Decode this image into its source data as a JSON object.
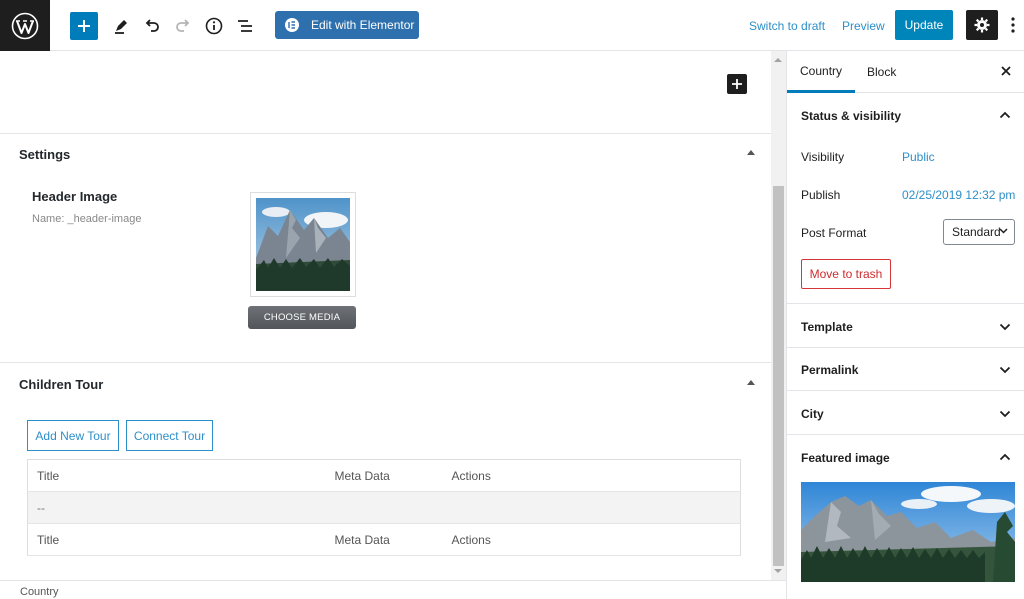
{
  "toolbar": {
    "edit_elementor_label": "Edit with Elementor",
    "switch_draft_label": "Switch to draft",
    "preview_label": "Preview",
    "update_label": "Update"
  },
  "settings_box": {
    "title": "Settings",
    "field_label": "Header Image",
    "field_name": "Name: _header-image",
    "choose_media_label": "CHOOSE MEDIA"
  },
  "children_box": {
    "title": "Children Tour",
    "add_new_label": "Add New Tour",
    "connect_label": "Connect Tour",
    "table": {
      "header": [
        "Title",
        "Meta Data",
        "Actions"
      ],
      "empty_row": "--",
      "footer": [
        "Title",
        "Meta Data",
        "Actions"
      ]
    }
  },
  "sidebar": {
    "tabs": [
      {
        "label": "Country",
        "active": true
      },
      {
        "label": "Block",
        "active": false
      }
    ],
    "status_panel": {
      "title": "Status & visibility",
      "visibility_label": "Visibility",
      "visibility_value": "Public",
      "publish_label": "Publish",
      "publish_value": "02/25/2019 12:32 pm",
      "post_format_label": "Post Format",
      "post_format_value": "Standard",
      "trash_label": "Move to trash"
    },
    "panels": [
      {
        "title": "Template"
      },
      {
        "title": "Permalink"
      },
      {
        "title": "City"
      },
      {
        "title": "Featured image"
      }
    ]
  },
  "footer": {
    "breadcrumb": "Country"
  },
  "colors": {
    "accent": "#007cba",
    "link": "#2d8fc9",
    "danger": "#d63638",
    "dark": "#1e1e1e"
  }
}
